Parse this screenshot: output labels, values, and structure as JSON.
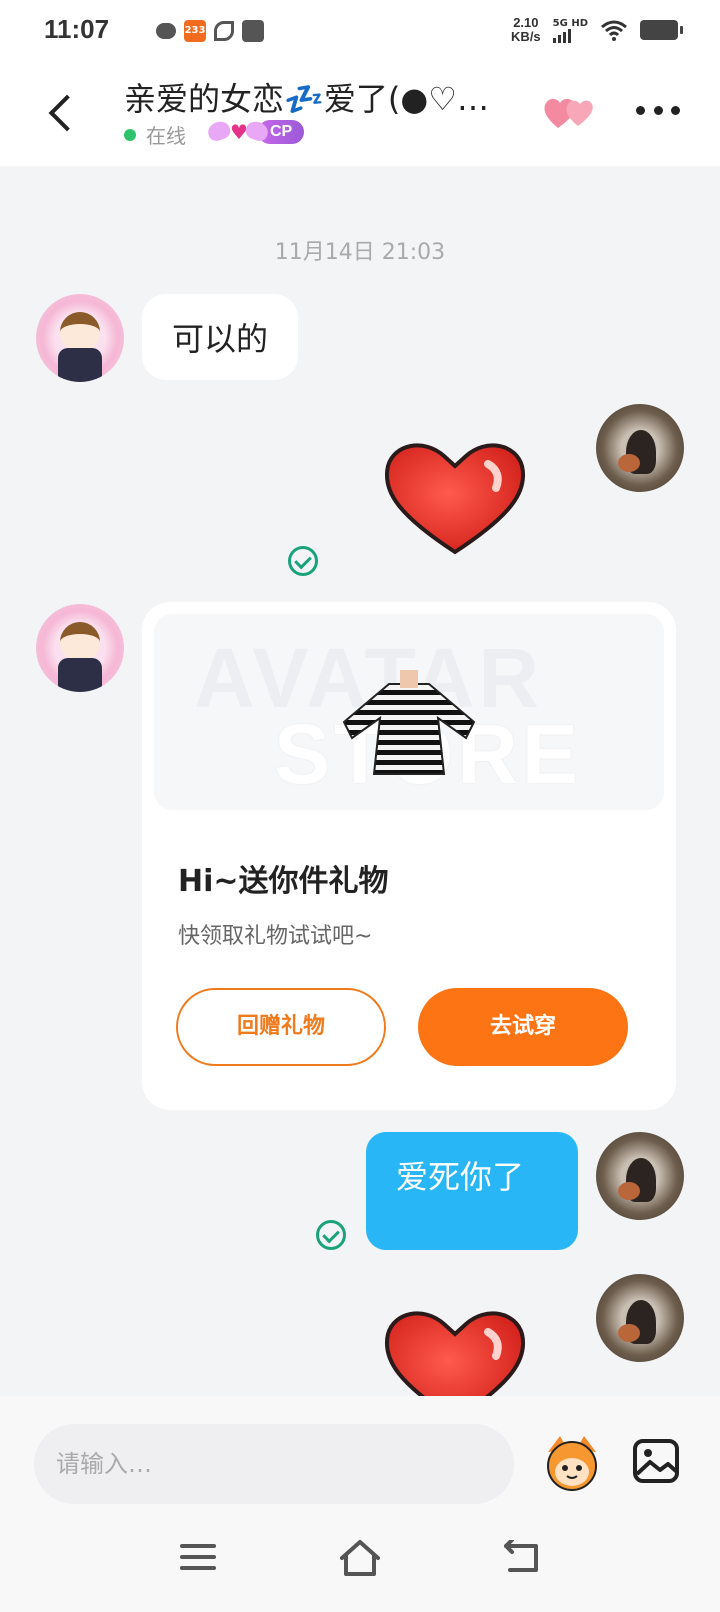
{
  "status_bar": {
    "time": "11:07",
    "net_speed_value": "2.10",
    "net_speed_unit": "KB/s",
    "signal_label": "5G HD",
    "app_badge": "233",
    "icons": [
      "wechat-icon",
      "app-233-icon",
      "leaf-icon",
      "bag-icon",
      "signal-icon",
      "wifi-icon",
      "battery-icon"
    ]
  },
  "header": {
    "title": "亲爱的女恋💤爱了(●♡…",
    "status_text": "在线",
    "cp_label": "CP",
    "online_color": "#2ec26a"
  },
  "chat": {
    "timestamp": "11月14日 21:03",
    "messages": [
      {
        "side": "left",
        "text": "可以的"
      },
      {
        "side": "right",
        "type": "sticker",
        "sticker": "heart"
      },
      {
        "side": "left",
        "type": "gift_card"
      },
      {
        "side": "right",
        "text": "爱死你了"
      },
      {
        "side": "right",
        "type": "sticker",
        "sticker": "heart"
      }
    ],
    "gift_card": {
      "watermark_line1": "AVATAR",
      "watermark_line2": "STORE",
      "title": "Hi~送你件礼物",
      "subtitle": "快领取礼物试试吧~",
      "return_gift_label": "回赠礼物",
      "try_on_label": "去试穿",
      "accent_color": "#fd7414"
    }
  },
  "input": {
    "placeholder": "请输入…"
  },
  "colors": {
    "bubble_blue": "#29b6f6",
    "check_green": "#1aa37a"
  }
}
